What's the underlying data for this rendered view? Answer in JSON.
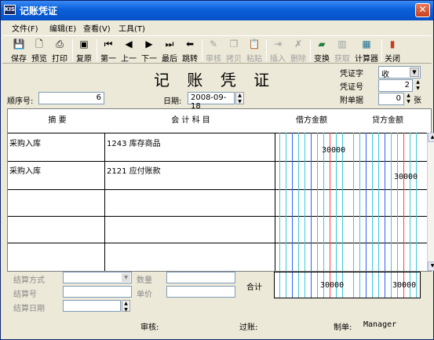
{
  "window": {
    "title": "记账凭证",
    "app_icon_text": "KIS"
  },
  "menu": [
    "文件(F)",
    "编辑(E)",
    "查看(V)",
    "工具(T)"
  ],
  "toolbar": [
    {
      "label": "保存",
      "icon": "floppy-icon",
      "enabled": true
    },
    {
      "label": "预览",
      "icon": "preview-icon",
      "enabled": true
    },
    {
      "label": "打印",
      "icon": "printer-icon",
      "enabled": true
    },
    {
      "label": "复原",
      "icon": "restore-icon",
      "enabled": true
    },
    {
      "label": "第一",
      "icon": "first-icon",
      "enabled": true
    },
    {
      "label": "上一",
      "icon": "prev-icon",
      "enabled": true
    },
    {
      "label": "下一",
      "icon": "next-icon",
      "enabled": true
    },
    {
      "label": "最后",
      "icon": "last-icon",
      "enabled": true
    },
    {
      "label": "跳转",
      "icon": "jump-icon",
      "enabled": true
    },
    {
      "label": "审核",
      "icon": "audit-icon",
      "enabled": false
    },
    {
      "label": "拷贝",
      "icon": "copy-icon",
      "enabled": false
    },
    {
      "label": "粘贴",
      "icon": "paste-icon",
      "enabled": false
    },
    {
      "label": "插入",
      "icon": "insert-icon",
      "enabled": false
    },
    {
      "label": "删除",
      "icon": "delete-icon",
      "enabled": false
    },
    {
      "label": "变换",
      "icon": "transform-icon",
      "enabled": true
    },
    {
      "label": "获取",
      "icon": "fetch-icon",
      "enabled": false
    },
    {
      "label": "计算器",
      "icon": "calculator-icon",
      "enabled": true
    },
    {
      "label": "关闭",
      "icon": "close-door-icon",
      "enabled": true
    }
  ],
  "voucher": {
    "title": "记 账 凭 证",
    "seq_label": "顺序号:",
    "seq_value": "6",
    "date_label": "日期:",
    "date_value": "2008-09-18",
    "voucher_word_label": "凭证字",
    "voucher_word_value": "收",
    "voucher_no_label": "凭证号",
    "voucher_no_value": "2",
    "attach_label": "附单据",
    "attach_value": "0",
    "attach_unit": "张"
  },
  "grid": {
    "headers": {
      "summary": "摘 要",
      "account": "会 计 科 目",
      "debit": "借方金额",
      "credit": "贷方金额"
    },
    "rows": [
      {
        "summary": "采购入库",
        "account": "1243 库存商品",
        "debit": "30000",
        "credit": ""
      },
      {
        "summary": "采购入库",
        "account": "2121 应付账款",
        "debit": "",
        "credit": "30000"
      },
      {
        "summary": "",
        "account": "",
        "debit": "",
        "credit": ""
      },
      {
        "summary": "",
        "account": "",
        "debit": "",
        "credit": ""
      },
      {
        "summary": "",
        "account": "",
        "debit": "",
        "credit": ""
      }
    ],
    "total_label": "合计",
    "total_debit": "30000",
    "total_credit": "30000"
  },
  "settlement": {
    "method_label": "结算方式",
    "number_label": "结算号",
    "date_label": "结算日期",
    "qty_label": "数量",
    "price_label": "单价"
  },
  "status": {
    "audit_label": "审核:",
    "post_label": "过账:",
    "maker_label": "制单:",
    "maker_value": "Manager"
  },
  "colors": {
    "accent": "#0a5fd8",
    "grid_red": "#ff4040",
    "grid_cyan": "#40c8d8",
    "grid_blue": "#3060ff"
  }
}
